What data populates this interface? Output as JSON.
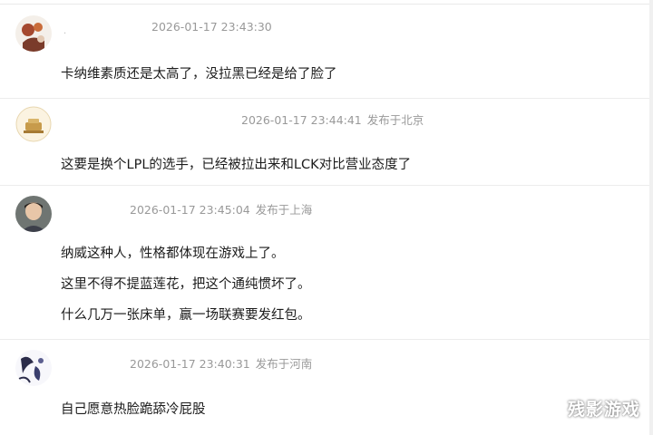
{
  "comments": [
    {
      "timestamp": "2026-01-17 23:43:30",
      "location": "",
      "lines": [
        "卡纳维素质还是太高了，没拉黑已经是给了脸了"
      ]
    },
    {
      "timestamp": "2026-01-17 23:44:41",
      "location": "发布于北京",
      "lines": [
        "这要是换个LPL的选手，已经被拉出来和LCK对比营业态度了"
      ]
    },
    {
      "timestamp": "2026-01-17 23:45:04",
      "location": "发布于上海",
      "lines": [
        "纳威这种人，性格都体现在游戏上了。",
        "这里不得不提蓝莲花，把这个通纯惯坏了。",
        "什么几万一张床单，赢一场联赛要发红包。"
      ]
    },
    {
      "timestamp": "2026-01-17 23:40:31",
      "location": "发布于河南",
      "lines": [
        "自己愿意热脸跪舔冷屁股"
      ]
    }
  ],
  "watermark": "残影游戏"
}
